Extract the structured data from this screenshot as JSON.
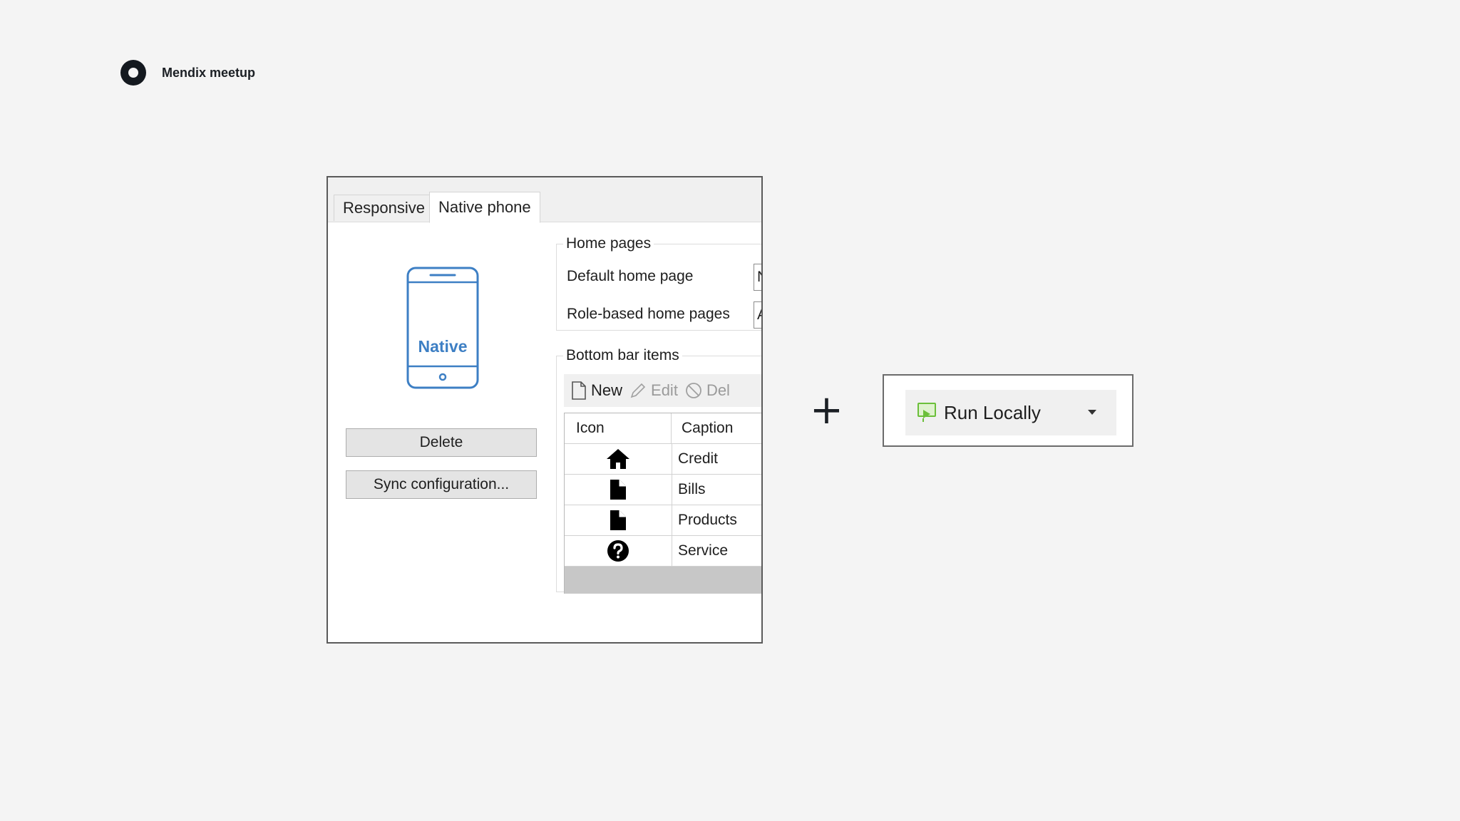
{
  "brand": {
    "title": "Mendix meetup"
  },
  "tabs": [
    {
      "label": "Responsive",
      "active": false
    },
    {
      "label": "Native phone",
      "active": true
    }
  ],
  "profile": {
    "phone_label": "Native"
  },
  "buttons": {
    "delete": "Delete",
    "sync": "Sync configuration..."
  },
  "home_pages": {
    "legend": "Home pages",
    "default_label": "Default home page",
    "default_value": "N",
    "role_label": "Role-based home pages",
    "role_value": "A"
  },
  "bottom_bar": {
    "legend": "Bottom bar items",
    "toolbar": {
      "new": "New",
      "edit": "Edit",
      "delete": "Del"
    },
    "columns": {
      "icon": "Icon",
      "caption": "Caption"
    },
    "rows": [
      {
        "icon": "home-icon",
        "caption": "Credit"
      },
      {
        "icon": "file-icon",
        "caption": "Bills"
      },
      {
        "icon": "file-icon",
        "caption": "Products"
      },
      {
        "icon": "question-circle-icon",
        "caption": "Service"
      }
    ]
  },
  "operator": "+",
  "run": {
    "label": "Run Locally",
    "icon": "run-locally-icon",
    "accent": "#6bbf3a"
  },
  "colors": {
    "phone_stroke": "#3d7fc4",
    "phone_text": "#3d7fc4"
  }
}
